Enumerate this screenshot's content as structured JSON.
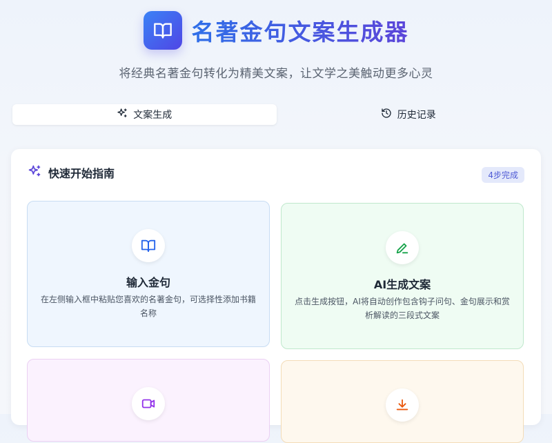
{
  "header": {
    "title": "名著金句文案生成器",
    "subtitle": "将经典名著金句转化为精美文案，让文学之美触动更多心灵",
    "logo_icon": "book-open-icon"
  },
  "tabs": [
    {
      "label": "文案生成",
      "icon": "sparkles-icon",
      "active": true
    },
    {
      "label": "历史记录",
      "icon": "history-icon",
      "active": false
    }
  ],
  "guide": {
    "title": "快速开始指南",
    "badge": "4步完成",
    "steps": [
      {
        "title": "输入金句",
        "desc": "在左侧输入框中粘贴您喜欢的名著金句，可选择性添加书籍名称",
        "icon": "book-open-icon",
        "color": "#2563eb"
      },
      {
        "title": "AI生成文案",
        "desc": "点击生成按钮，AI将自动创作包含钩子问句、金句展示和赏析解读的三段式文案",
        "icon": "pencil-icon",
        "color": "#16a34a"
      },
      {
        "title": "",
        "desc": "",
        "icon": "video-icon",
        "color": "#9333ea"
      },
      {
        "title": "",
        "desc": "",
        "icon": "download-icon",
        "color": "#ea580c"
      }
    ]
  },
  "colors": {
    "accent_start": "#2f6fe8",
    "accent_end": "#5b45d9",
    "badge_bg": "#e4e9fb",
    "badge_text": "#4f5bd5"
  }
}
